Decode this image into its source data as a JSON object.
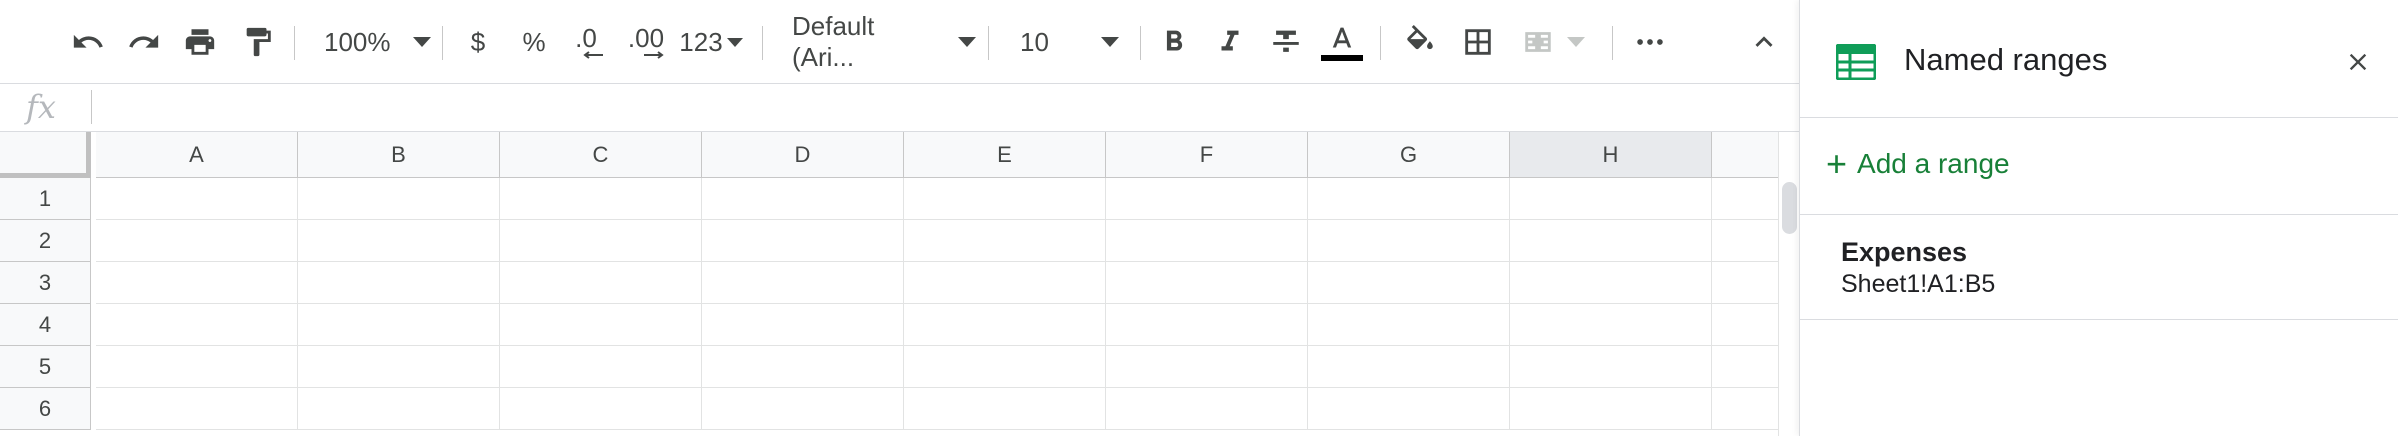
{
  "toolbar": {
    "zoom": "100%",
    "currency": "$",
    "percent": "%",
    "decrease_decimal": ".0",
    "increase_decimal": ".00",
    "more_formats": "123",
    "font": "Default (Ari...",
    "font_size": "10",
    "text_color": "#000000"
  },
  "formula": {
    "fx": "fx",
    "value": ""
  },
  "grid": {
    "columns": [
      "A",
      "B",
      "C",
      "D",
      "E",
      "F",
      "G",
      "H"
    ],
    "selected_column": "H",
    "rows": [
      "1",
      "2",
      "3",
      "4",
      "5",
      "6"
    ]
  },
  "panel": {
    "title": "Named ranges",
    "add_plus": "+",
    "add_label": "Add a range",
    "ranges": [
      {
        "name": "Expenses",
        "ref": "Sheet1!A1:B5"
      }
    ]
  },
  "colors": {
    "accent_green": "#188038",
    "sheets_icon_green": "#0f9d58",
    "header_bg": "#f8f9fa",
    "selected_header_bg": "#e8eaed"
  }
}
